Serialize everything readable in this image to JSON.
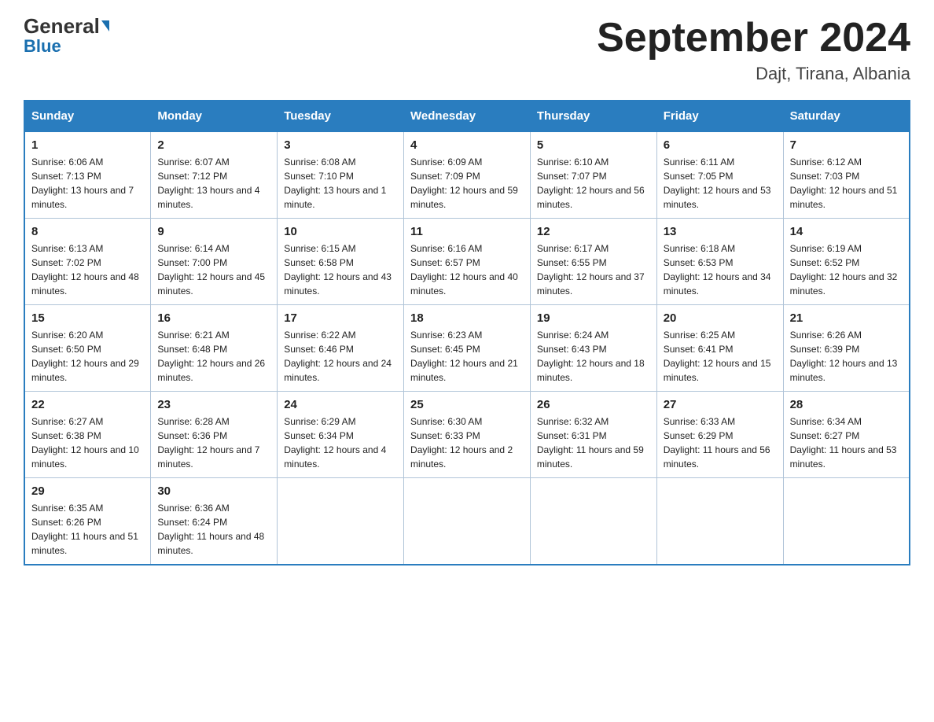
{
  "header": {
    "logo_general": "General",
    "logo_blue": "Blue",
    "month_title": "September 2024",
    "location": "Dajt, Tirana, Albania"
  },
  "days_of_week": [
    "Sunday",
    "Monday",
    "Tuesday",
    "Wednesday",
    "Thursday",
    "Friday",
    "Saturday"
  ],
  "weeks": [
    [
      {
        "day": "1",
        "sunrise": "Sunrise: 6:06 AM",
        "sunset": "Sunset: 7:13 PM",
        "daylight": "Daylight: 13 hours and 7 minutes."
      },
      {
        "day": "2",
        "sunrise": "Sunrise: 6:07 AM",
        "sunset": "Sunset: 7:12 PM",
        "daylight": "Daylight: 13 hours and 4 minutes."
      },
      {
        "day": "3",
        "sunrise": "Sunrise: 6:08 AM",
        "sunset": "Sunset: 7:10 PM",
        "daylight": "Daylight: 13 hours and 1 minute."
      },
      {
        "day": "4",
        "sunrise": "Sunrise: 6:09 AM",
        "sunset": "Sunset: 7:09 PM",
        "daylight": "Daylight: 12 hours and 59 minutes."
      },
      {
        "day": "5",
        "sunrise": "Sunrise: 6:10 AM",
        "sunset": "Sunset: 7:07 PM",
        "daylight": "Daylight: 12 hours and 56 minutes."
      },
      {
        "day": "6",
        "sunrise": "Sunrise: 6:11 AM",
        "sunset": "Sunset: 7:05 PM",
        "daylight": "Daylight: 12 hours and 53 minutes."
      },
      {
        "day": "7",
        "sunrise": "Sunrise: 6:12 AM",
        "sunset": "Sunset: 7:03 PM",
        "daylight": "Daylight: 12 hours and 51 minutes."
      }
    ],
    [
      {
        "day": "8",
        "sunrise": "Sunrise: 6:13 AM",
        "sunset": "Sunset: 7:02 PM",
        "daylight": "Daylight: 12 hours and 48 minutes."
      },
      {
        "day": "9",
        "sunrise": "Sunrise: 6:14 AM",
        "sunset": "Sunset: 7:00 PM",
        "daylight": "Daylight: 12 hours and 45 minutes."
      },
      {
        "day": "10",
        "sunrise": "Sunrise: 6:15 AM",
        "sunset": "Sunset: 6:58 PM",
        "daylight": "Daylight: 12 hours and 43 minutes."
      },
      {
        "day": "11",
        "sunrise": "Sunrise: 6:16 AM",
        "sunset": "Sunset: 6:57 PM",
        "daylight": "Daylight: 12 hours and 40 minutes."
      },
      {
        "day": "12",
        "sunrise": "Sunrise: 6:17 AM",
        "sunset": "Sunset: 6:55 PM",
        "daylight": "Daylight: 12 hours and 37 minutes."
      },
      {
        "day": "13",
        "sunrise": "Sunrise: 6:18 AM",
        "sunset": "Sunset: 6:53 PM",
        "daylight": "Daylight: 12 hours and 34 minutes."
      },
      {
        "day": "14",
        "sunrise": "Sunrise: 6:19 AM",
        "sunset": "Sunset: 6:52 PM",
        "daylight": "Daylight: 12 hours and 32 minutes."
      }
    ],
    [
      {
        "day": "15",
        "sunrise": "Sunrise: 6:20 AM",
        "sunset": "Sunset: 6:50 PM",
        "daylight": "Daylight: 12 hours and 29 minutes."
      },
      {
        "day": "16",
        "sunrise": "Sunrise: 6:21 AM",
        "sunset": "Sunset: 6:48 PM",
        "daylight": "Daylight: 12 hours and 26 minutes."
      },
      {
        "day": "17",
        "sunrise": "Sunrise: 6:22 AM",
        "sunset": "Sunset: 6:46 PM",
        "daylight": "Daylight: 12 hours and 24 minutes."
      },
      {
        "day": "18",
        "sunrise": "Sunrise: 6:23 AM",
        "sunset": "Sunset: 6:45 PM",
        "daylight": "Daylight: 12 hours and 21 minutes."
      },
      {
        "day": "19",
        "sunrise": "Sunrise: 6:24 AM",
        "sunset": "Sunset: 6:43 PM",
        "daylight": "Daylight: 12 hours and 18 minutes."
      },
      {
        "day": "20",
        "sunrise": "Sunrise: 6:25 AM",
        "sunset": "Sunset: 6:41 PM",
        "daylight": "Daylight: 12 hours and 15 minutes."
      },
      {
        "day": "21",
        "sunrise": "Sunrise: 6:26 AM",
        "sunset": "Sunset: 6:39 PM",
        "daylight": "Daylight: 12 hours and 13 minutes."
      }
    ],
    [
      {
        "day": "22",
        "sunrise": "Sunrise: 6:27 AM",
        "sunset": "Sunset: 6:38 PM",
        "daylight": "Daylight: 12 hours and 10 minutes."
      },
      {
        "day": "23",
        "sunrise": "Sunrise: 6:28 AM",
        "sunset": "Sunset: 6:36 PM",
        "daylight": "Daylight: 12 hours and 7 minutes."
      },
      {
        "day": "24",
        "sunrise": "Sunrise: 6:29 AM",
        "sunset": "Sunset: 6:34 PM",
        "daylight": "Daylight: 12 hours and 4 minutes."
      },
      {
        "day": "25",
        "sunrise": "Sunrise: 6:30 AM",
        "sunset": "Sunset: 6:33 PM",
        "daylight": "Daylight: 12 hours and 2 minutes."
      },
      {
        "day": "26",
        "sunrise": "Sunrise: 6:32 AM",
        "sunset": "Sunset: 6:31 PM",
        "daylight": "Daylight: 11 hours and 59 minutes."
      },
      {
        "day": "27",
        "sunrise": "Sunrise: 6:33 AM",
        "sunset": "Sunset: 6:29 PM",
        "daylight": "Daylight: 11 hours and 56 minutes."
      },
      {
        "day": "28",
        "sunrise": "Sunrise: 6:34 AM",
        "sunset": "Sunset: 6:27 PM",
        "daylight": "Daylight: 11 hours and 53 minutes."
      }
    ],
    [
      {
        "day": "29",
        "sunrise": "Sunrise: 6:35 AM",
        "sunset": "Sunset: 6:26 PM",
        "daylight": "Daylight: 11 hours and 51 minutes."
      },
      {
        "day": "30",
        "sunrise": "Sunrise: 6:36 AM",
        "sunset": "Sunset: 6:24 PM",
        "daylight": "Daylight: 11 hours and 48 minutes."
      },
      null,
      null,
      null,
      null,
      null
    ]
  ]
}
